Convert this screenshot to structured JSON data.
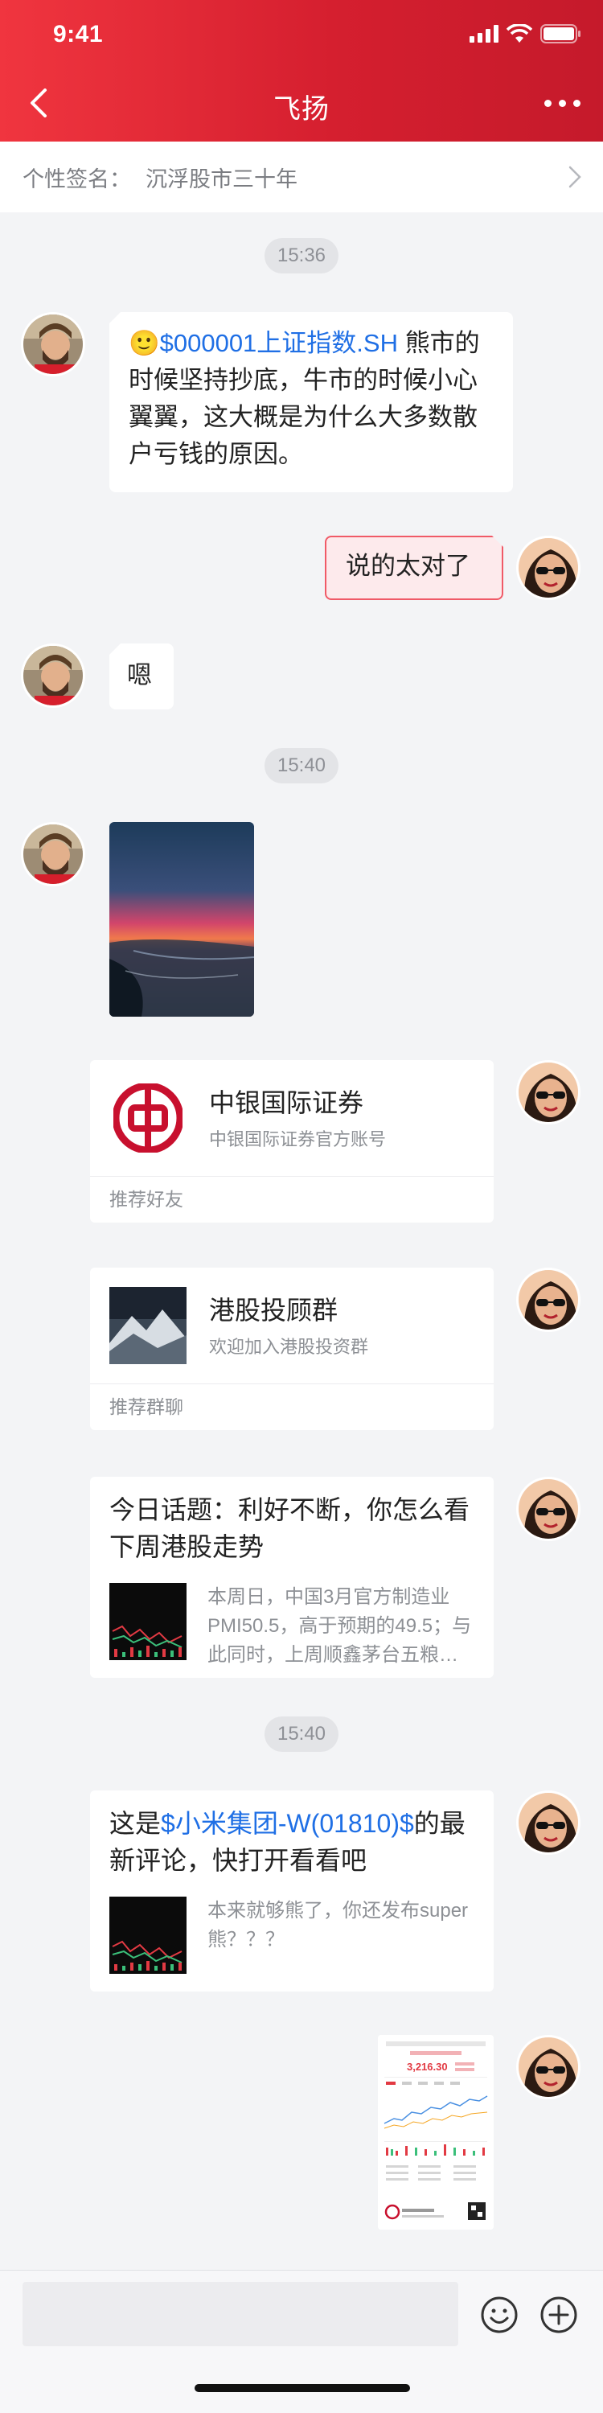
{
  "status_bar": {
    "time": "9:41"
  },
  "header": {
    "title": "飞扬"
  },
  "signature": {
    "label": "个性签名：",
    "value": "沉浮股市三十年"
  },
  "timestamps": [
    "15:36",
    "15:40",
    "15:40"
  ],
  "messages": {
    "m1": {
      "emoji": "🙂",
      "stock": "$000001上证指数.SH",
      "text": " 熊市的时候坚持抄底，牛市的时候小心翼翼，这大概是为什么大多数散户亏钱的原因。"
    },
    "m2": {
      "text": "说的太对了"
    },
    "m3": {
      "text": "嗯"
    },
    "contact_card": {
      "title": "中银国际证券",
      "subtitle": "中银国际证券官方账号",
      "footer": "推荐好友"
    },
    "group_card": {
      "title": "港股投顾群",
      "subtitle": "欢迎加入港股投资群",
      "footer": "推荐群聊"
    },
    "topic_card": {
      "title": "今日话题：利好不断，你怎么看下周港股走势",
      "desc": "本周日，中国3月官方制造业PMI50.5，高于预期的49.5；与此同时，上周顺鑫茅台五粮…"
    },
    "comment_card": {
      "prefix": "这是",
      "stock": "$小米集团-W(01810)$",
      "suffix": "的最新评论，快打开看看吧",
      "desc": "本来就够熊了，你还发布super熊？？？"
    },
    "stock_shot": {
      "price": "3,216.30"
    }
  },
  "colors": {
    "brand_red": "#e02a36",
    "link_blue": "#1f6fe5",
    "bank_red": "#c8102e"
  },
  "icons": [
    "back-arrow-icon",
    "more-dots-icon",
    "chevron-right-icon",
    "emoji-icon",
    "plus-icon"
  ]
}
